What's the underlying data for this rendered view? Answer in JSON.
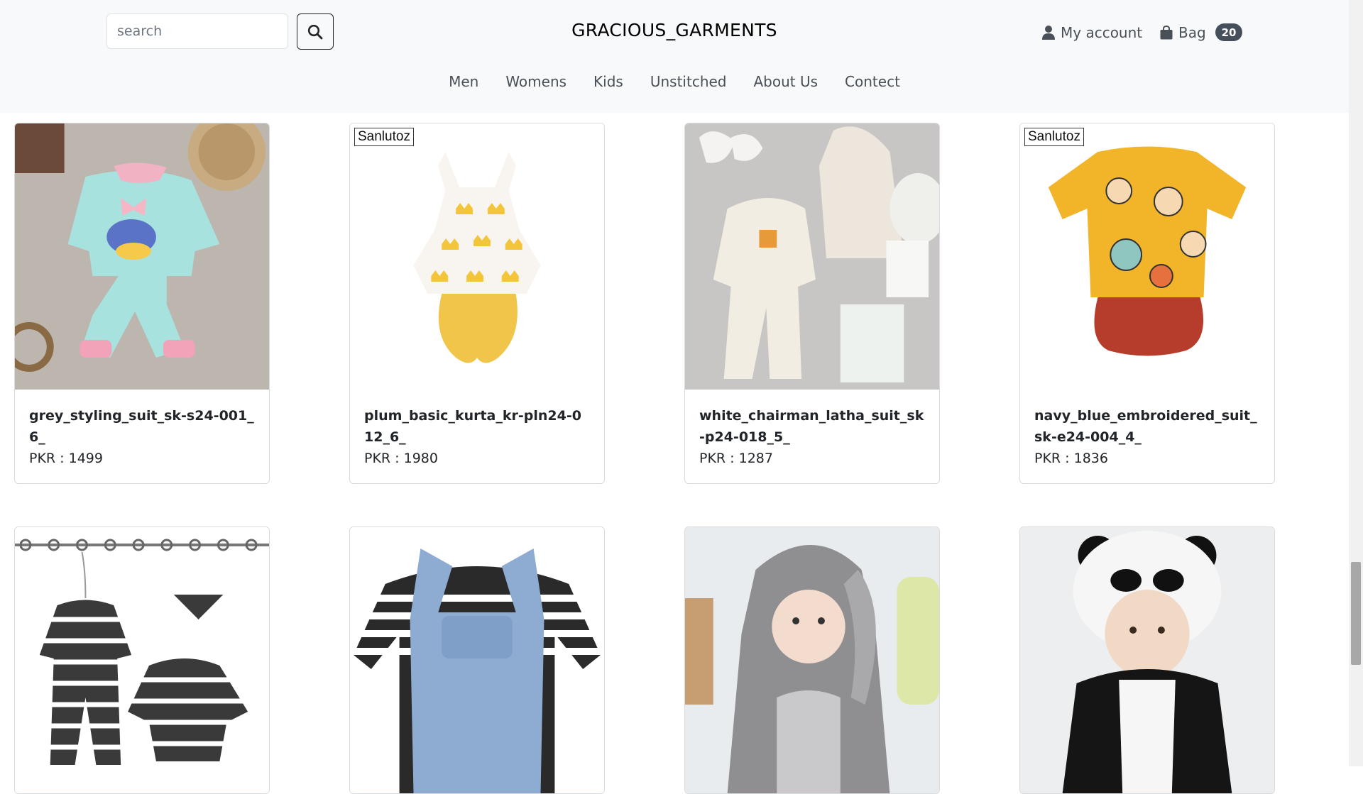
{
  "header": {
    "search_placeholder": "search",
    "brand": "GRACIOUS_GARMENTS",
    "account_label": "My account",
    "bag_label": "Bag",
    "bag_count": "20"
  },
  "nav": [
    "Men",
    "Womens",
    "Kids",
    "Unstitched",
    "About Us",
    "Contect"
  ],
  "products": [
    {
      "title": "grey_styling_suit_sk-s24-001_6_",
      "price": "PKR : 1499",
      "image_brand": ""
    },
    {
      "title": "plum_basic_kurta_kr-pln24-012_6_",
      "price": "PKR : 1980",
      "image_brand": "Sanlutoz"
    },
    {
      "title": "white_chairman_latha_suit_sk-p24-018_5_",
      "price": "PKR : 1287",
      "image_brand": ""
    },
    {
      "title": "navy_blue_embroidered_suit_sk-e24-004_4_",
      "price": "PKR : 1836",
      "image_brand": "Sanlutoz"
    }
  ],
  "colors": {
    "topbar_bg": "#f8f9fa",
    "badge_bg": "#454e5b",
    "nav_text": "#495057"
  },
  "icons": [
    "search-icon",
    "user-icon",
    "bag-icon"
  ]
}
